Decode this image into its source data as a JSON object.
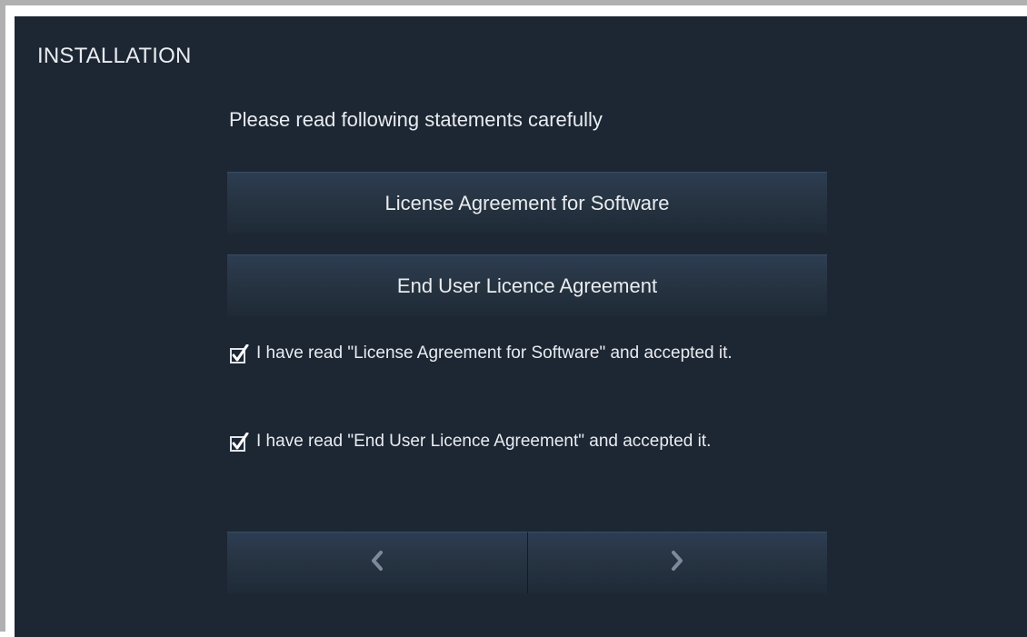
{
  "header": {
    "title": "INSTALLATION"
  },
  "main": {
    "instruction": "Please read following statements carefully",
    "documents": [
      {
        "label": "License Agreement for Software"
      },
      {
        "label": "End User Licence Agreement"
      }
    ],
    "agreements": [
      {
        "text": "I have read \"License Agreement for Software\" and accepted it.",
        "checked": true
      },
      {
        "text": "I have read \"End User Licence Agreement\"  and accepted it.",
        "checked": true
      }
    ]
  },
  "navigation": {
    "prev_icon": "chevron-left-icon",
    "next_icon": "chevron-right-icon"
  },
  "colors": {
    "background": "#1d2633",
    "button": "#263342",
    "text": "#e8ecf0",
    "icon": "#7d8a9b"
  }
}
